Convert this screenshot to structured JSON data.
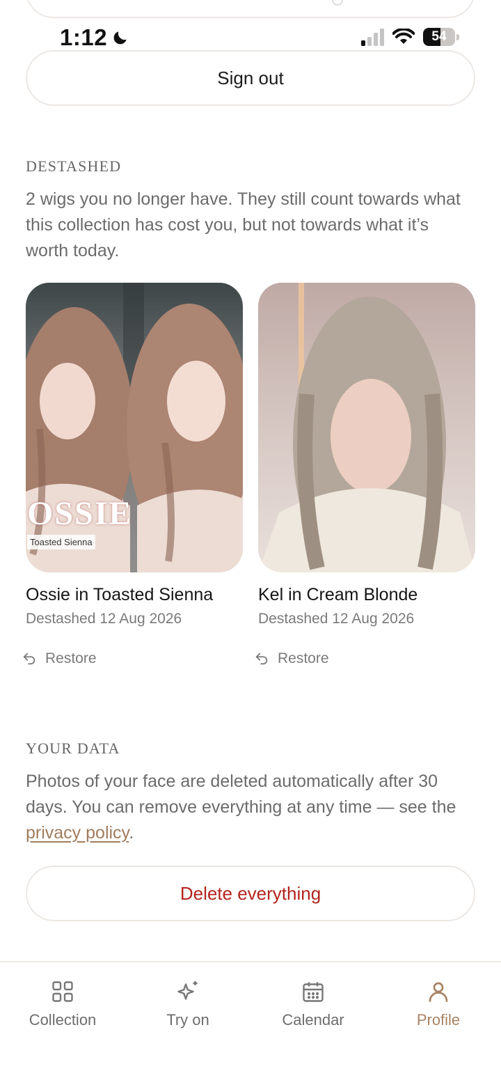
{
  "status_bar": {
    "time": "1:12",
    "battery": "54",
    "battery_level_percent": 54
  },
  "account": {
    "sign_out_label": "Sign out"
  },
  "destashed": {
    "heading": "DESTASHED",
    "description": "2 wigs you no longer have. They still count towards what this collection has cost you, but not towards what it’s worth today.",
    "items": [
      {
        "name": "Ossie in Toasted Sienna",
        "date": "Destashed 12 Aug 2026",
        "restore_label": "Restore",
        "photo_overlay_title": "OSSIE",
        "photo_overlay_tag": "Toasted Sienna"
      },
      {
        "name": "Kel in Cream Blonde",
        "date": "Destashed 12 Aug 2026",
        "restore_label": "Restore"
      }
    ]
  },
  "your_data": {
    "heading": "YOUR DATA",
    "text_before_link": "Photos of your face are deleted automatically after 30 days. You can remove everything at any time — see the ",
    "link_label": "privacy policy",
    "text_after_link": ".",
    "delete_label": "Delete everything"
  },
  "nav": {
    "items": [
      {
        "label": "Collection",
        "icon": "grid-icon"
      },
      {
        "label": "Try on",
        "icon": "sparkles-icon"
      },
      {
        "label": "Calendar",
        "icon": "calendar-icon"
      },
      {
        "label": "Profile",
        "icon": "person-icon"
      }
    ],
    "active": "Profile"
  },
  "colors": {
    "accent": "#a88464",
    "danger": "#b3241e",
    "link": "#a07c5e",
    "muted_text": "#6b6b6b"
  }
}
